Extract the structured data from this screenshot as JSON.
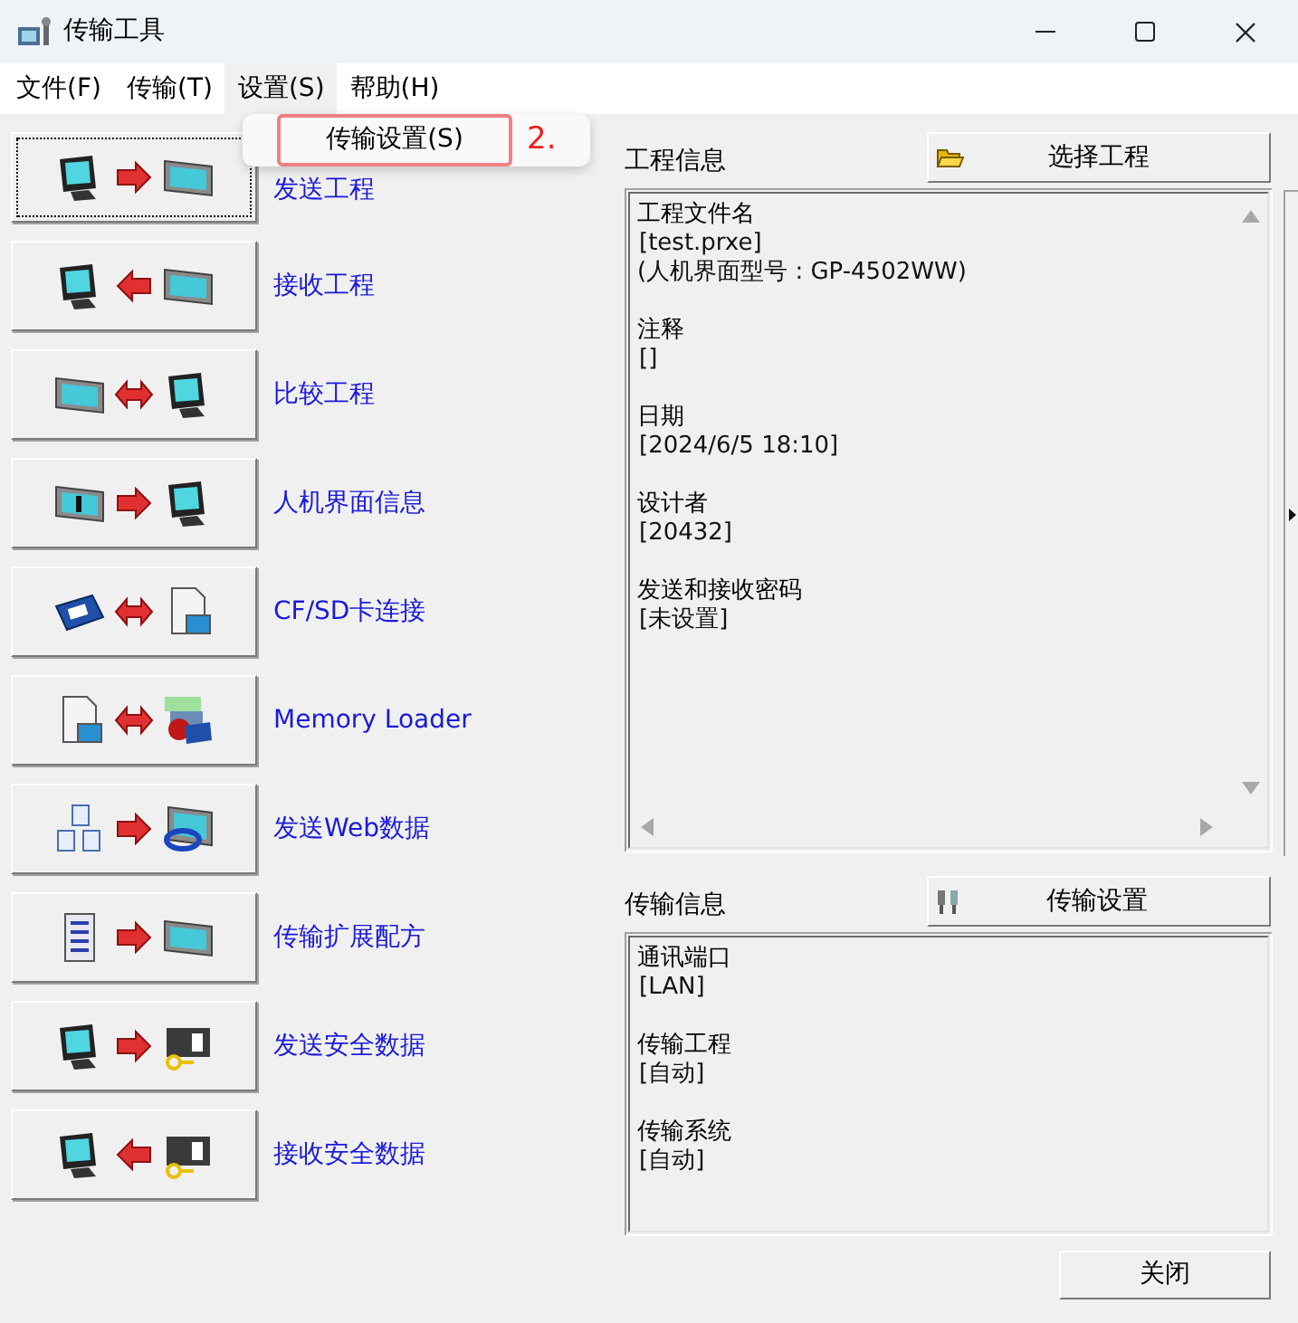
{
  "window": {
    "title": "传输工具"
  },
  "menu": [
    {
      "label": "文件(F)",
      "selected": false
    },
    {
      "label": "传输(T)",
      "selected": false
    },
    {
      "label": "设置(S)",
      "selected": true
    },
    {
      "label": "帮助(H)",
      "selected": false
    }
  ],
  "dropdown": {
    "items": [
      {
        "label": "传输设置(S)",
        "highlighted": true
      }
    ],
    "annotation": "2."
  },
  "actions": [
    {
      "label": "发送工程",
      "icons": [
        {
          "kind": "computer"
        },
        {
          "kind": "right"
        },
        {
          "kind": "display"
        }
      ],
      "focused": true
    },
    {
      "label": "接收工程",
      "icons": [
        {
          "kind": "computer"
        },
        {
          "kind": "left"
        },
        {
          "kind": "display"
        }
      ],
      "focused": false
    },
    {
      "label": "比较工程",
      "icons": [
        {
          "kind": "display"
        },
        {
          "kind": "both"
        },
        {
          "kind": "computer"
        }
      ],
      "focused": false
    },
    {
      "label": "人机界面信息",
      "icons": [
        {
          "kind": "info"
        },
        {
          "kind": "right"
        },
        {
          "kind": "computer"
        }
      ],
      "focused": false
    },
    {
      "label": "CF/SD卡连接",
      "icons": [
        {
          "kind": "card"
        },
        {
          "kind": "both"
        },
        {
          "kind": "file"
        }
      ],
      "focused": false
    },
    {
      "label": "Memory Loader",
      "icons": [
        {
          "kind": "file"
        },
        {
          "kind": "both"
        },
        {
          "kind": "backup"
        }
      ],
      "focused": false
    },
    {
      "label": "发送Web数据",
      "icons": [
        {
          "kind": "docs"
        },
        {
          "kind": "right"
        },
        {
          "kind": "web"
        }
      ],
      "focused": false
    },
    {
      "label": "传输扩展配方",
      "icons": [
        {
          "kind": "list"
        },
        {
          "kind": "right"
        },
        {
          "kind": "display"
        }
      ],
      "focused": false
    },
    {
      "label": "发送安全数据",
      "icons": [
        {
          "kind": "computer"
        },
        {
          "kind": "right"
        },
        {
          "kind": "secure"
        }
      ],
      "focused": false
    },
    {
      "label": "接收安全数据",
      "icons": [
        {
          "kind": "computer"
        },
        {
          "kind": "left"
        },
        {
          "kind": "secure"
        }
      ],
      "focused": false
    }
  ],
  "project_info": {
    "title": "工程信息",
    "button": "选择工程",
    "fields": [
      {
        "label": "工程文件名",
        "values": [
          "[test.prxe]",
          "(人机界面型号 : GP-4502WW)"
        ]
      },
      {
        "label": "注释",
        "values": [
          "[]"
        ]
      },
      {
        "label": "日期",
        "values": [
          "[2024/6/5 18:10]"
        ]
      },
      {
        "label": "设计者",
        "values": [
          "[20432]"
        ]
      },
      {
        "label": "发送和接收密码",
        "values": [
          "[未设置]"
        ]
      }
    ]
  },
  "transfer_info": {
    "title": "传输信息",
    "button": "传输设置",
    "fields": [
      {
        "label": "通讯端口",
        "values": [
          "[LAN]"
        ]
      },
      {
        "label": "传输工程",
        "values": [
          "[自动]"
        ]
      },
      {
        "label": "传输系统",
        "values": [
          "[自动]"
        ]
      }
    ]
  },
  "close_button": "关闭"
}
